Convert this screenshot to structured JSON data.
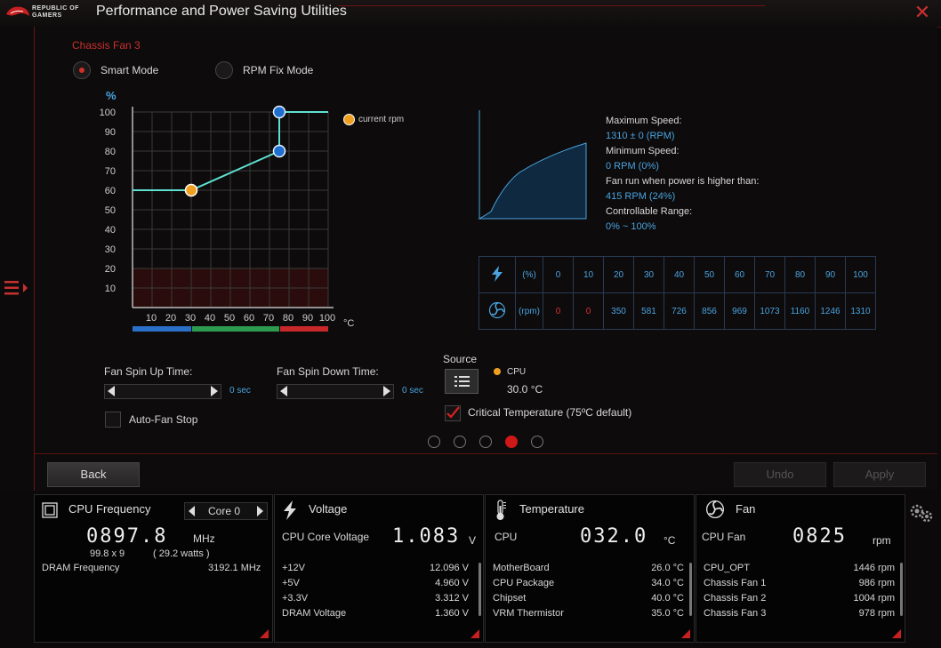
{
  "app": {
    "title": "Performance and Power Saving Utilities",
    "logo_line1": "REPUBLIC OF",
    "logo_line2": "GAMERS"
  },
  "fan_panel": {
    "fan_name": "Chassis Fan 3",
    "smart_mode_label": "Smart Mode",
    "rpm_fix_label": "RPM Fix Mode",
    "selected_mode": "Smart Mode",
    "y_unit": "%",
    "x_unit": "°C",
    "y_ticks": [
      "100",
      "90",
      "80",
      "70",
      "60",
      "50",
      "40",
      "30",
      "20",
      "10"
    ],
    "x_ticks": [
      "10",
      "20",
      "30",
      "40",
      "50",
      "60",
      "70",
      "80",
      "90",
      "100"
    ],
    "legend_current_rpm": "current rpm",
    "curve_points": [
      {
        "t": 0,
        "p": 60
      },
      {
        "t": 30,
        "p": 60
      },
      {
        "t": 75,
        "p": 80
      },
      {
        "t": 75,
        "p": 100
      },
      {
        "t": 100,
        "p": 100
      }
    ],
    "current_point": {
      "t": 30,
      "p": 60
    },
    "zone_colors": [
      "#2a6fc8",
      "#2e9a50",
      "#c8282a"
    ],
    "max_speed_label": "Maximum Speed:",
    "max_speed_value": "1310 ± 0 (RPM)",
    "min_speed_label": "Minimum Speed:",
    "min_speed_value": "0 RPM (0%)",
    "fan_run_label": "Fan run when power is higher than:",
    "fan_run_value": "415 RPM (24%)",
    "range_label": "Controllable Range:",
    "range_value": "0% ~ 100%",
    "table_pct_unit": "(%)",
    "table_rpm_unit": "(rpm)",
    "table_pct": [
      "0",
      "10",
      "20",
      "30",
      "40",
      "50",
      "60",
      "70",
      "80",
      "90",
      "100"
    ],
    "table_rpm": [
      "0",
      "0",
      "350",
      "581",
      "726",
      "856",
      "969",
      "1073",
      "1160",
      "1246",
      "1310"
    ],
    "spin_up_label": "Fan Spin Up Time:",
    "spin_up_value": "0 sec",
    "spin_down_label": "Fan Spin Down Time:",
    "spin_down_value": "0 sec",
    "auto_fan_stop_label": "Auto-Fan Stop",
    "source_label": "Source",
    "source_name": "CPU",
    "source_temp": "30.0 °C",
    "critical_label": "Critical Temperature (75ºC default)",
    "page_count": 5,
    "active_page": 4,
    "back_label": "Back",
    "undo_label": "Undo",
    "apply_label": "Apply"
  },
  "status": {
    "cpu": {
      "title": "CPU Frequency",
      "core_label": "Core 0",
      "freq": "0897.8",
      "freq_unit": "MHz",
      "multiplier": "99.8  x  9",
      "watts": "( 29.2   watts )",
      "dram_label": "DRAM Frequency",
      "dram_value": "3192.1  MHz"
    },
    "voltage": {
      "title": "Voltage",
      "core_label": "CPU Core Voltage",
      "core_value": "1.083",
      "core_unit": "V",
      "rows": [
        {
          "name": "+12V",
          "value": "12.096  V"
        },
        {
          "name": "+5V",
          "value": "4.960  V"
        },
        {
          "name": "+3.3V",
          "value": "3.312  V"
        },
        {
          "name": "DRAM Voltage",
          "value": "1.360  V"
        }
      ]
    },
    "temperature": {
      "title": "Temperature",
      "cpu_label": "CPU",
      "cpu_value": "032.0",
      "cpu_unit": "°C",
      "rows": [
        {
          "name": "MotherBoard",
          "value": "26.0 °C"
        },
        {
          "name": "CPU Package",
          "value": "34.0 °C"
        },
        {
          "name": "Chipset",
          "value": "40.0 °C"
        },
        {
          "name": "VRM Thermistor",
          "value": "35.0 °C"
        }
      ]
    },
    "fan": {
      "title": "Fan",
      "cpu_label": "CPU Fan",
      "cpu_value": "0825",
      "cpu_unit": "rpm",
      "rows": [
        {
          "name": "CPU_OPT",
          "value": "1446  rpm"
        },
        {
          "name": "Chassis Fan 1",
          "value": "986  rpm"
        },
        {
          "name": "Chassis Fan 2",
          "value": "1004  rpm"
        },
        {
          "name": "Chassis Fan 3",
          "value": "978  rpm"
        }
      ]
    }
  },
  "colors": {
    "accent_red": "#c83030",
    "value_blue": "#4aa3e0",
    "curve": "#5ee0d0",
    "point_blue": "#1e6fd0",
    "point_orange": "#f0a020"
  }
}
